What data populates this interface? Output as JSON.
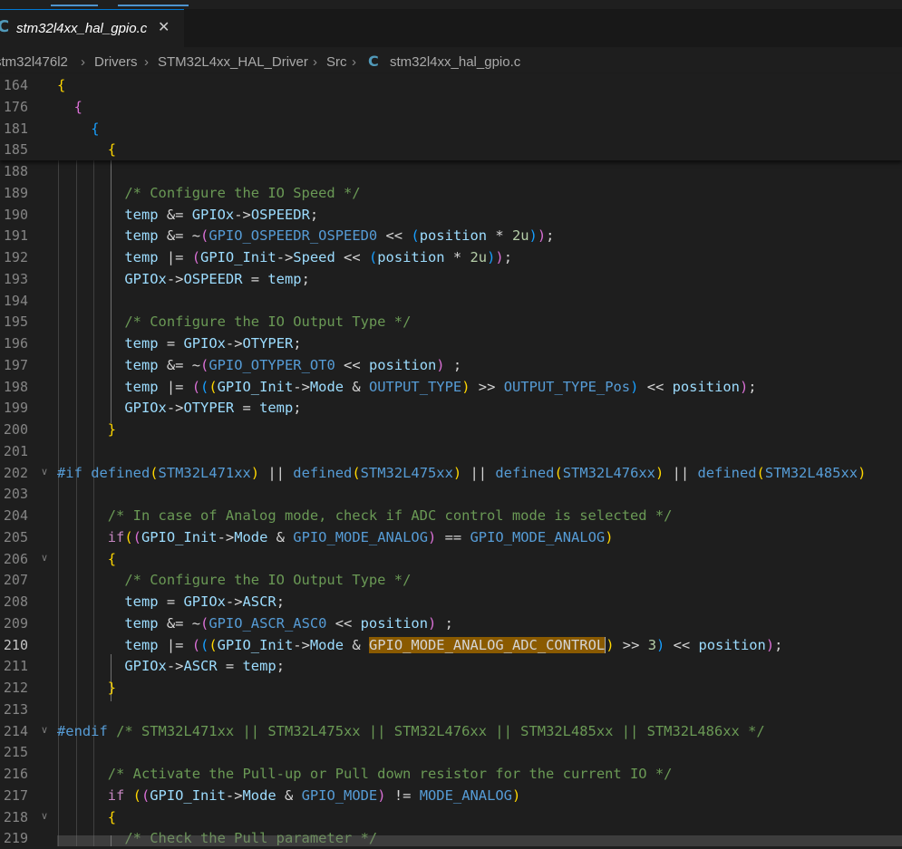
{
  "tab": {
    "title": "stm32l4xx_hal_gpio.c",
    "close": "✕",
    "icon": "C"
  },
  "breadcrumb": [
    {
      "label": "stm32l476l2"
    },
    {
      "label": "Drivers"
    },
    {
      "label": "STM32L4xx_HAL_Driver"
    },
    {
      "label": "Src"
    },
    {
      "label": "stm32l4xx_hal_gpio.c",
      "icon": "C"
    }
  ],
  "colors": {
    "accent": "#0078d4",
    "selection_highlight": "#8a5a00",
    "c_file_icon": "#519aba"
  },
  "editor": {
    "current_line": "210",
    "sticky_lines": [
      {
        "n": "164",
        "tokens": [
          [
            "{",
            "b1"
          ]
        ]
      },
      {
        "n": "176",
        "tokens": [
          [
            "  "
          ],
          [
            "{",
            "b2"
          ]
        ]
      },
      {
        "n": "181",
        "tokens": [
          [
            "    "
          ],
          [
            "{",
            "b3"
          ]
        ]
      },
      {
        "n": "185",
        "tokens": [
          [
            "      "
          ],
          [
            "{",
            "b1"
          ]
        ]
      }
    ],
    "lines": [
      {
        "n": "188",
        "tokens": [
          [
            "       "
          ]
        ]
      },
      {
        "n": "189",
        "tokens": [
          [
            "        "
          ],
          [
            "/* Configure the IO Speed */",
            "c-cm"
          ]
        ]
      },
      {
        "n": "190",
        "tokens": [
          [
            "        "
          ],
          [
            "temp",
            "c-var"
          ],
          [
            " &= "
          ],
          [
            "GPIOx",
            "c-var"
          ],
          [
            "->"
          ],
          [
            "OSPEEDR",
            "c-fld"
          ],
          [
            ";"
          ]
        ]
      },
      {
        "n": "191",
        "tokens": [
          [
            "        "
          ],
          [
            "temp",
            "c-var"
          ],
          [
            " &= ~"
          ],
          [
            "(",
            "b2"
          ],
          [
            "GPIO_OSPEEDR_OSPEED0",
            "c-mac"
          ],
          [
            " << "
          ],
          [
            "(",
            "b3"
          ],
          [
            "position",
            "c-var"
          ],
          [
            " * "
          ],
          [
            "2u",
            "c-num"
          ],
          [
            ")",
            "b3"
          ],
          [
            ")",
            "b2"
          ],
          [
            ";"
          ]
        ]
      },
      {
        "n": "192",
        "tokens": [
          [
            "        "
          ],
          [
            "temp",
            "c-var"
          ],
          [
            " |= "
          ],
          [
            "(",
            "b2"
          ],
          [
            "GPIO_Init",
            "c-var"
          ],
          [
            "->"
          ],
          [
            "Speed",
            "c-fld"
          ],
          [
            " << "
          ],
          [
            "(",
            "b3"
          ],
          [
            "position",
            "c-var"
          ],
          [
            " * "
          ],
          [
            "2u",
            "c-num"
          ],
          [
            ")",
            "b3"
          ],
          [
            ")",
            "b2"
          ],
          [
            ";"
          ]
        ]
      },
      {
        "n": "193",
        "tokens": [
          [
            "        "
          ],
          [
            "GPIOx",
            "c-var"
          ],
          [
            "->"
          ],
          [
            "OSPEEDR",
            "c-fld"
          ],
          [
            " = "
          ],
          [
            "temp",
            "c-var"
          ],
          [
            ";"
          ]
        ]
      },
      {
        "n": "194",
        "tokens": [
          [
            " "
          ]
        ]
      },
      {
        "n": "195",
        "tokens": [
          [
            "        "
          ],
          [
            "/* Configure the IO Output Type */",
            "c-cm"
          ]
        ]
      },
      {
        "n": "196",
        "tokens": [
          [
            "        "
          ],
          [
            "temp",
            "c-var"
          ],
          [
            " = "
          ],
          [
            "GPIOx",
            "c-var"
          ],
          [
            "->"
          ],
          [
            "OTYPER",
            "c-fld"
          ],
          [
            ";"
          ]
        ]
      },
      {
        "n": "197",
        "tokens": [
          [
            "        "
          ],
          [
            "temp",
            "c-var"
          ],
          [
            " &= ~"
          ],
          [
            "(",
            "b2"
          ],
          [
            "GPIO_OTYPER_OT0",
            "c-mac"
          ],
          [
            " << "
          ],
          [
            "position",
            "c-var"
          ],
          [
            ")",
            "b2"
          ],
          [
            " ;"
          ]
        ]
      },
      {
        "n": "198",
        "tokens": [
          [
            "        "
          ],
          [
            "temp",
            "c-var"
          ],
          [
            " |= "
          ],
          [
            "(",
            "b2"
          ],
          [
            "(",
            "b3"
          ],
          [
            "(",
            "b1"
          ],
          [
            "GPIO_Init",
            "c-var"
          ],
          [
            "->"
          ],
          [
            "Mode",
            "c-fld"
          ],
          [
            " & "
          ],
          [
            "OUTPUT_TYPE",
            "c-mac"
          ],
          [
            ")",
            "b1"
          ],
          [
            " >> "
          ],
          [
            "OUTPUT_TYPE_Pos",
            "c-mac"
          ],
          [
            ")",
            "b3"
          ],
          [
            " << "
          ],
          [
            "position",
            "c-var"
          ],
          [
            ")",
            "b2"
          ],
          [
            ";"
          ]
        ]
      },
      {
        "n": "199",
        "tokens": [
          [
            "        "
          ],
          [
            "GPIOx",
            "c-var"
          ],
          [
            "->"
          ],
          [
            "OTYPER",
            "c-fld"
          ],
          [
            " = "
          ],
          [
            "temp",
            "c-var"
          ],
          [
            ";"
          ]
        ]
      },
      {
        "n": "200",
        "tokens": [
          [
            "      "
          ],
          [
            "}",
            "b1"
          ]
        ]
      },
      {
        "n": "201",
        "tokens": [
          [
            " "
          ]
        ]
      },
      {
        "n": "202",
        "fold": "v",
        "tokens": [
          [
            "#if",
            "c-pp"
          ],
          [
            " "
          ],
          [
            "defined",
            "c-pp"
          ],
          [
            "(",
            "b1"
          ],
          [
            "STM32L471xx",
            "c-mac"
          ],
          [
            ")",
            "b1"
          ],
          [
            " || "
          ],
          [
            "defined",
            "c-pp"
          ],
          [
            "(",
            "b1"
          ],
          [
            "STM32L475xx",
            "c-mac"
          ],
          [
            ")",
            "b1"
          ],
          [
            " || "
          ],
          [
            "defined",
            "c-pp"
          ],
          [
            "(",
            "b1"
          ],
          [
            "STM32L476xx",
            "c-mac"
          ],
          [
            ")",
            "b1"
          ],
          [
            " || "
          ],
          [
            "defined",
            "c-pp"
          ],
          [
            "(",
            "b1"
          ],
          [
            "STM32L485xx",
            "c-mac"
          ],
          [
            ")",
            "b1"
          ]
        ]
      },
      {
        "n": "203",
        "tokens": [
          [
            " "
          ]
        ]
      },
      {
        "n": "204",
        "tokens": [
          [
            "      "
          ],
          [
            "/* In case of Analog mode, check if ADC control mode is selected */",
            "c-cm"
          ]
        ]
      },
      {
        "n": "205",
        "tokens": [
          [
            "      "
          ],
          [
            "if",
            "c-kw"
          ],
          [
            "(",
            "b1"
          ],
          [
            "(",
            "b2"
          ],
          [
            "GPIO_Init",
            "c-var"
          ],
          [
            "->"
          ],
          [
            "Mode",
            "c-fld"
          ],
          [
            " & "
          ],
          [
            "GPIO_MODE_ANALOG",
            "c-mac"
          ],
          [
            ")",
            "b2"
          ],
          [
            " == "
          ],
          [
            "GPIO_MODE_ANALOG",
            "c-mac"
          ],
          [
            ")",
            "b1"
          ]
        ]
      },
      {
        "n": "206",
        "fold": "v",
        "tokens": [
          [
            "      "
          ],
          [
            "{",
            "b1"
          ]
        ]
      },
      {
        "n": "207",
        "tokens": [
          [
            "        "
          ],
          [
            "/* Configure the IO Output Type */",
            "c-cm"
          ]
        ]
      },
      {
        "n": "208",
        "tokens": [
          [
            "        "
          ],
          [
            "temp",
            "c-var"
          ],
          [
            " = "
          ],
          [
            "GPIOx",
            "c-var"
          ],
          [
            "->"
          ],
          [
            "ASCR",
            "c-fld"
          ],
          [
            ";"
          ]
        ]
      },
      {
        "n": "209",
        "tokens": [
          [
            "        "
          ],
          [
            "temp",
            "c-var"
          ],
          [
            " &= ~"
          ],
          [
            "(",
            "b2"
          ],
          [
            "GPIO_ASCR_ASC0",
            "c-mac"
          ],
          [
            " << "
          ],
          [
            "position",
            "c-var"
          ],
          [
            ")",
            "b2"
          ],
          [
            " ;"
          ]
        ]
      },
      {
        "n": "210",
        "tokens": [
          [
            "        "
          ],
          [
            "temp",
            "c-var"
          ],
          [
            " |= "
          ],
          [
            "(",
            "b2"
          ],
          [
            "(",
            "b3"
          ],
          [
            "(",
            "b1"
          ],
          [
            "GPIO_Init",
            "c-var"
          ],
          [
            "->"
          ],
          [
            "Mode",
            "c-fld"
          ],
          [
            " & "
          ],
          [
            "GPIO_MODE_ANALOG_ADC_CONTROL",
            "hl cursor"
          ],
          [
            ")",
            "b1"
          ],
          [
            " >> "
          ],
          [
            "3",
            "c-num"
          ],
          [
            ")",
            "b3"
          ],
          [
            " << "
          ],
          [
            "position",
            "c-var"
          ],
          [
            ")",
            "b2"
          ],
          [
            ";"
          ]
        ]
      },
      {
        "n": "211",
        "tokens": [
          [
            "        "
          ],
          [
            "GPIOx",
            "c-var"
          ],
          [
            "->"
          ],
          [
            "ASCR",
            "c-fld"
          ],
          [
            " = "
          ],
          [
            "temp",
            "c-var"
          ],
          [
            ";"
          ]
        ]
      },
      {
        "n": "212",
        "tokens": [
          [
            "      "
          ],
          [
            "}",
            "b1"
          ]
        ]
      },
      {
        "n": "213",
        "tokens": [
          [
            " "
          ]
        ]
      },
      {
        "n": "214",
        "fold": "v",
        "tokens": [
          [
            "#endif",
            "c-pp"
          ],
          [
            " "
          ],
          [
            "/* STM32L471xx || STM32L475xx || STM32L476xx || STM32L485xx || STM32L486xx */",
            "c-cm"
          ]
        ]
      },
      {
        "n": "215",
        "tokens": [
          [
            " "
          ]
        ]
      },
      {
        "n": "216",
        "tokens": [
          [
            "      "
          ],
          [
            "/* Activate the Pull-up or Pull down resistor for the current IO */",
            "c-cm"
          ]
        ]
      },
      {
        "n": "217",
        "tokens": [
          [
            "      "
          ],
          [
            "if",
            "c-kw"
          ],
          [
            " "
          ],
          [
            "(",
            "b1"
          ],
          [
            "(",
            "b2"
          ],
          [
            "GPIO_Init",
            "c-var"
          ],
          [
            "->"
          ],
          [
            "Mode",
            "c-fld"
          ],
          [
            " & "
          ],
          [
            "GPIO_MODE",
            "c-mac"
          ],
          [
            ")",
            "b2"
          ],
          [
            " != "
          ],
          [
            "MODE_ANALOG",
            "c-mac"
          ],
          [
            ")",
            "b1"
          ]
        ]
      },
      {
        "n": "218",
        "fold": "v",
        "tokens": [
          [
            "      "
          ],
          [
            "{",
            "b1"
          ]
        ]
      },
      {
        "n": "219",
        "tokens": [
          [
            "        "
          ],
          [
            "/* Check the Pull parameter */",
            "c-cm"
          ]
        ]
      }
    ]
  }
}
